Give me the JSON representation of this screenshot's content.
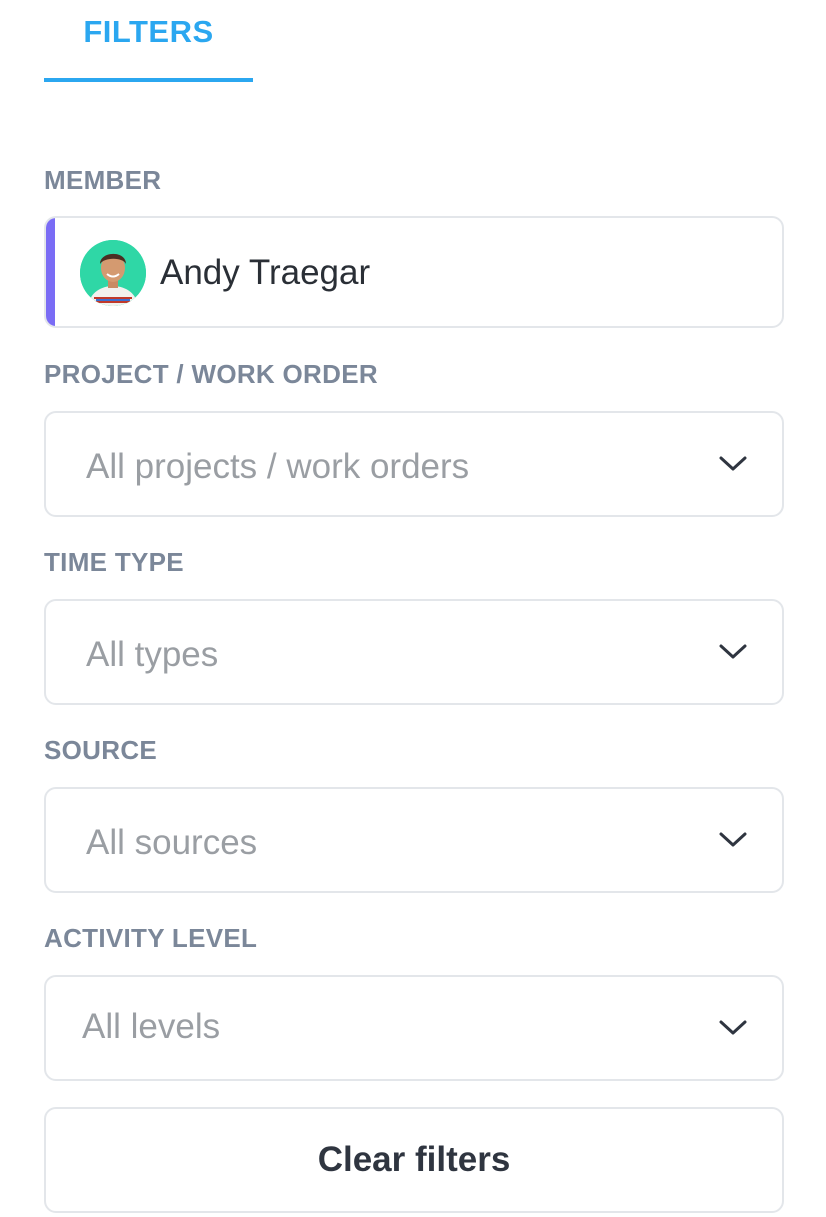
{
  "tab": {
    "label": "FILTERS"
  },
  "member": {
    "label": "MEMBER",
    "name": "Andy Traegar",
    "avatar_icon": "user-avatar",
    "accent_color": "#7a6cf5"
  },
  "project": {
    "label": "PROJECT / WORK ORDER",
    "value": "All projects / work orders"
  },
  "time_type": {
    "label": "TIME TYPE",
    "value": "All types"
  },
  "source": {
    "label": "SOURCE",
    "value": "All sources"
  },
  "activity": {
    "label": "ACTIVITY LEVEL",
    "value": "All levels"
  },
  "clear_button": {
    "label": "Clear filters"
  },
  "colors": {
    "accent": "#2ba7f0",
    "label": "#7b8799",
    "border": "#e3e6ea",
    "placeholder": "#9a9ea3"
  }
}
